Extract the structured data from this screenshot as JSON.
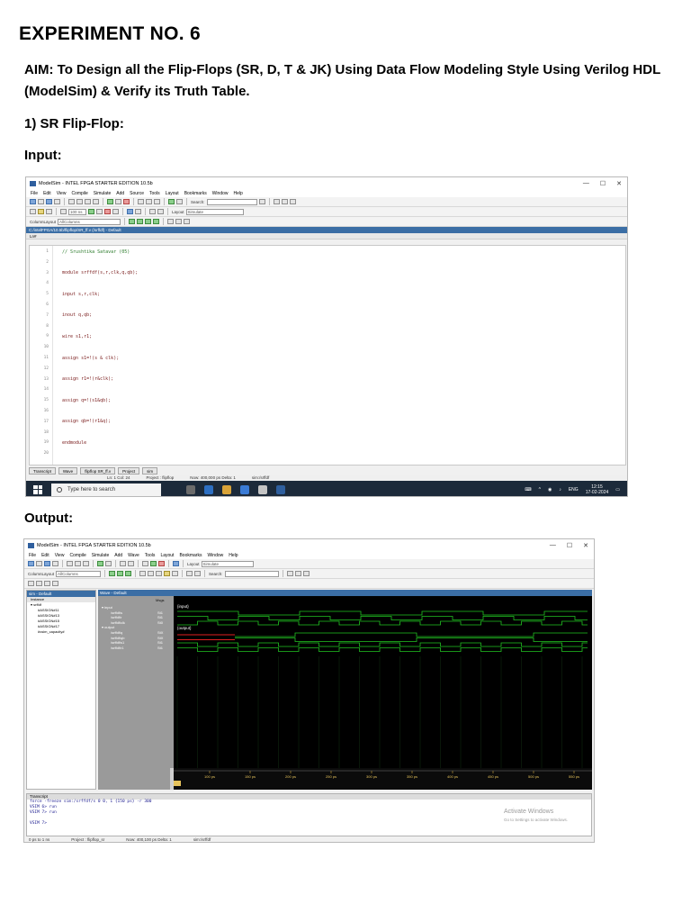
{
  "document": {
    "title": "EXPERIMENT NO. 6",
    "aim": "AIM: To Design all the Flip-Flops (SR, D, T & JK) Using Data Flow Modeling Style Using Verilog HDL (ModelSim) & Verify its Truth Table.",
    "section_heading": "1) SR Flip-Flop:",
    "input_heading": "Input:",
    "output_heading": "Output:"
  },
  "editor_window": {
    "title": "ModelSim - INTEL FPGA STARTER EDITION 10.5b",
    "window_controls": [
      "—",
      "☐",
      "✕"
    ],
    "menu": [
      "File",
      "Edit",
      "View",
      "Compile",
      "Simulate",
      "Add",
      "Source",
      "Tools",
      "Layout",
      "Bookmarks",
      "Window",
      "Help"
    ],
    "layout_label": "Layout",
    "layout_value": "Simulate",
    "search_label": "Search:",
    "column_layout_label": "ColumnLayout",
    "column_layout_value": "AllColumns",
    "run_length": "100 ns",
    "file_path": "C:/intelFPGA/10.5b/flipflop/SR_ff.v (/srffdf) - Default",
    "ln_header": "Ln#",
    "line_numbers": [
      "1",
      "2",
      "3",
      "4",
      "5",
      "6",
      "7",
      "8",
      "9",
      "10",
      "11",
      "12",
      "13",
      "14",
      "15",
      "16",
      "17",
      "18",
      "19",
      "20"
    ],
    "code_lines": [
      {
        "line": 1,
        "text": "// Srushtika Satavar (05)",
        "kind": "comment"
      },
      {
        "line": 3,
        "text": "module srffdf(s,r,clk,q,qb);",
        "kind": "code"
      },
      {
        "line": 5,
        "text": "input s,r,clk;",
        "kind": "code"
      },
      {
        "line": 7,
        "text": "inout q,qb;",
        "kind": "code"
      },
      {
        "line": 9,
        "text": "wire s1,r1;",
        "kind": "code"
      },
      {
        "line": 11,
        "text": "assign s1=!(s & clk);",
        "kind": "code"
      },
      {
        "line": 13,
        "text": "assign r1=!(r&clk);",
        "kind": "code"
      },
      {
        "line": 15,
        "text": "assign q=!(s1&qb);",
        "kind": "code"
      },
      {
        "line": 17,
        "text": "assign qb=!(r1&q);",
        "kind": "code"
      },
      {
        "line": 19,
        "text": "endmodule",
        "kind": "code"
      }
    ],
    "tabs": [
      "Transcript",
      "Wave",
      "flipflop SR_ff.v",
      "Project",
      "sim"
    ],
    "status": [
      "Ln: 1  Col: 24",
      "Project : flipflop",
      "Now: 400,000 ps  Delta: 1",
      "sim:/srffdf"
    ],
    "taskbar": {
      "search_placeholder": "Type here to search",
      "lang": "ENG",
      "time": "12:15",
      "date": "17-02-2024"
    }
  },
  "wave_window": {
    "title": "ModelSim - INTEL FPGA STARTER EDITION 10.5b",
    "menu": [
      "File",
      "Edit",
      "View",
      "Compile",
      "Simulate",
      "Add",
      "Wave",
      "Tools",
      "Layout",
      "Bookmarks",
      "Window",
      "Help"
    ],
    "layout_label": "Layout",
    "layout_value": "Simulate",
    "search_label": "Search:",
    "column_layout_label": "ColumnLayout",
    "column_layout_value": "AllColumns",
    "sim_pane_title": "sim - Default",
    "instance_header": "Instance",
    "instances": [
      "srffdf",
      "#ASSIGN#11",
      "#ASSIGN#13",
      "#ASSIGN#15",
      "#ASSIGN#17",
      "#vsim_capacity#"
    ],
    "wave_pane_title": "Wave - Default",
    "msgs_header": "Msgs",
    "groups": [
      {
        "name": "input",
        "label": "input",
        "signals": [
          {
            "name": "/srffdf/s",
            "value": "St1"
          },
          {
            "name": "/srffdf/r",
            "value": "St1"
          },
          {
            "name": "/srffdf/clk",
            "value": "St0"
          }
        ]
      },
      {
        "name": "output",
        "label": "output",
        "signals": [
          {
            "name": "/srffdf/q",
            "value": "StX"
          },
          {
            "name": "/srffdf/qb",
            "value": "StX"
          },
          {
            "name": "/srffdf/s1",
            "value": "St1"
          },
          {
            "name": "/srffdf/r1",
            "value": "St1"
          }
        ]
      }
    ],
    "now_label": "Now",
    "now_value": "400.00 ps",
    "cursor_label": "Cursor 1",
    "cursor_value": "0 ps",
    "time_ticks": [
      "100 ps",
      "150 ps",
      "200 ps",
      "250 ps",
      "300 ps",
      "350 ps",
      "400 ps",
      "450 ps",
      "500 ps",
      "550 ps",
      "600 ps",
      "650 ps",
      "700 ps"
    ],
    "tabs": [
      "sim",
      "flipflop_sr",
      "Wave"
    ],
    "transcript_title": "Transcript",
    "transcript_lines": [
      "force -freeze sim:/srffdf/s 0 0, 1 {150 ps} -r 300",
      "VSIM 6> run",
      "VSIM 7> run",
      "",
      "VSIM 7>"
    ],
    "activate_title": "Activate Windows",
    "activate_sub": "Go to Settings to activate Windows.",
    "status": [
      "0 ps to 1 ns",
      "Project : flipflop_sr",
      "Now: 400,100 ps  Delta: 1",
      "sim:/srffdf"
    ]
  },
  "colors": {
    "wave_green": "#22c322",
    "wave_red": "#e02020",
    "pane_blue": "#3b6ea5",
    "comment_green": "#2a7a2a",
    "code_red": "#7a1c1c"
  }
}
